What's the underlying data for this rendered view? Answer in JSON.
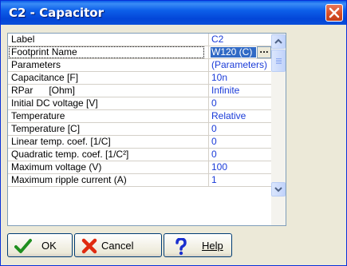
{
  "window": {
    "title": "C2 - Capacitor",
    "close_icon": "close-icon"
  },
  "properties": [
    {
      "label": "Label",
      "value": "C2"
    },
    {
      "label": "Footprint Name",
      "value": "W120 (C)"
    },
    {
      "label": "Parameters",
      "value": "(Parameters)"
    },
    {
      "label": "Capacitance  [F]",
      "value": "10n"
    },
    {
      "label": "RPar      [Ohm]",
      "value": "Infinite"
    },
    {
      "label": "Initial DC voltage  [V]",
      "value": "0"
    },
    {
      "label": "Temperature",
      "value": "Relative"
    },
    {
      "label": "Temperature [C]",
      "value": "0"
    },
    {
      "label": "Linear temp. coef. [1/C]",
      "value": "0"
    },
    {
      "label": "Quadratic temp. coef. [1/C²]",
      "value": "0"
    },
    {
      "label": "Maximum voltage (V)",
      "value": "100"
    },
    {
      "label": "Maximum ripple current (A)",
      "value": "1"
    }
  ],
  "ellipsis_label": "...",
  "buttons": {
    "ok": "OK",
    "cancel": "Cancel",
    "help": "Help"
  },
  "icons": {
    "ok": "checkmark-icon",
    "cancel": "cross-icon",
    "help": "question-icon",
    "scroll_up": "chevron-up-icon",
    "scroll_down": "chevron-down-icon"
  },
  "colors": {
    "title_bar": "#0346d8",
    "value_text": "#1a3bd8",
    "selection": "#316ac5",
    "close_button": "#d64b22"
  }
}
